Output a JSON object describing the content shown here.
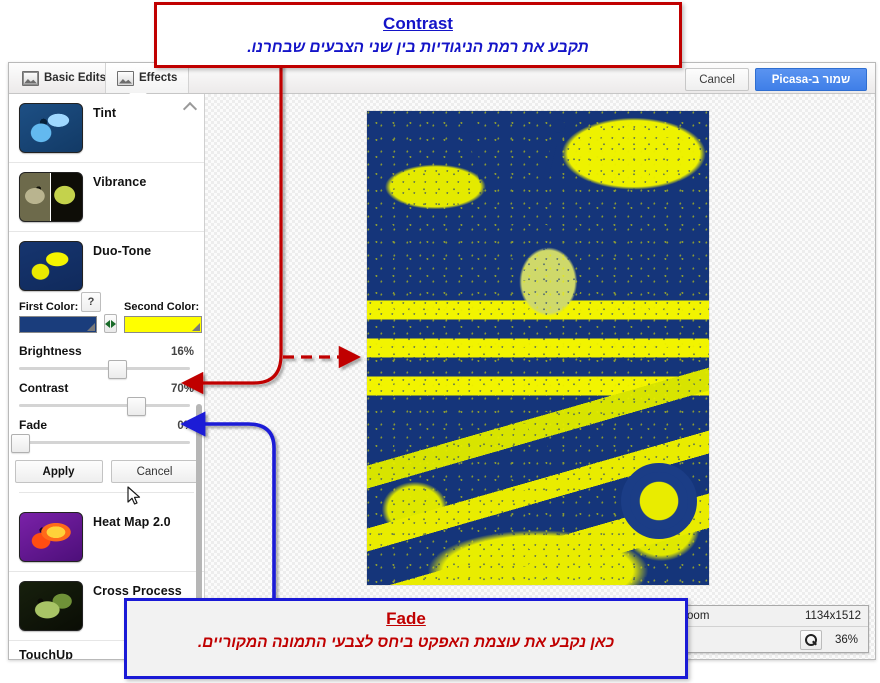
{
  "app": {
    "tabs": [
      {
        "label": "Basic Edits",
        "icon": "image-frame-icon",
        "active": false
      },
      {
        "label": "Effects",
        "icon": "picture-icon",
        "active": true
      }
    ],
    "top_actions": {
      "cancel_label": "Cancel",
      "save_label": "שמור ב-Picasa"
    }
  },
  "sidebar": {
    "effects": [
      {
        "name": "Tint",
        "thumb": "tint-thumbnail"
      },
      {
        "name": "Vibrance",
        "thumb": "vibrance-thumbnail"
      },
      {
        "name": "Duo-Tone",
        "thumb": "duo-tone-thumbnail",
        "expanded": true
      },
      {
        "name": "Heat Map 2.0",
        "thumb": "heat-map-thumbnail"
      },
      {
        "name": "Cross Process",
        "thumb": "cross-process-thumbnail"
      },
      {
        "name": "TouchUp",
        "thumb": "touchup-thumbnail"
      }
    ],
    "duotone_panel": {
      "help_label": "?",
      "first_color_label": "First Color:",
      "first_color_value": "#1a3d7c",
      "swap_label": "swap-colors",
      "second_color_label": "Second Color:",
      "second_color_value": "#ffff00",
      "sliders": [
        {
          "name": "Brightness",
          "value": "16%",
          "position": 57
        },
        {
          "name": "Contrast",
          "value": "70%",
          "position": 68
        },
        {
          "name": "Fade",
          "value": "0%",
          "position": 0
        }
      ],
      "apply_label": "Apply",
      "cancel_label": "Cancel"
    }
  },
  "canvas": {
    "zoom_panel": {
      "zoom_label": "Zoom",
      "dimensions": "1134x1512",
      "zoom_level": "36%"
    }
  },
  "callouts": {
    "top": {
      "title": "Contrast",
      "text": "תקבע את רמת הניגודיות בין שני הצבעים שבחרנו.",
      "border_color": "#c00000",
      "text_color": "#1414c8"
    },
    "bottom": {
      "title": "Fade",
      "text": "כאן נקבע את עוצמת האפקט ביחס לצבעי התמונה המקוריים.",
      "border_color": "#1a1ad6",
      "text_color": "#c00000"
    }
  }
}
